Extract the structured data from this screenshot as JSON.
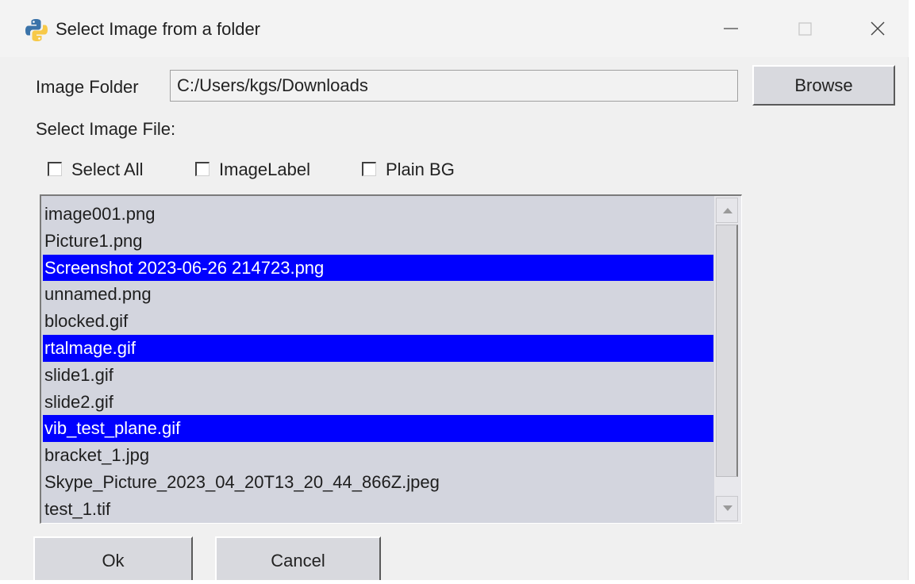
{
  "window": {
    "title": "Select Image from a folder",
    "app_icon": "python-icon",
    "controls": {
      "minimize_icon": "minimize-icon",
      "maximize_icon": "maximize-icon",
      "close_icon": "close-icon"
    }
  },
  "folder": {
    "label": "Image Folder",
    "value": "C:/Users/kgs/Downloads",
    "browse_label": "Browse"
  },
  "select_label": "Select Image File:",
  "checkboxes": [
    {
      "label": "Select All",
      "checked": false
    },
    {
      "label": "ImageLabel",
      "checked": false
    },
    {
      "label": "Plain BG",
      "checked": false
    }
  ],
  "files": [
    {
      "name": "image001.png",
      "selected": false
    },
    {
      "name": "Picture1.png",
      "selected": false
    },
    {
      "name": "Screenshot 2023-06-26 214723.png",
      "selected": true
    },
    {
      "name": "unnamed.png",
      "selected": false
    },
    {
      "name": "blocked.gif",
      "selected": false
    },
    {
      "name": "rtalmage.gif",
      "selected": true
    },
    {
      "name": "slide1.gif",
      "selected": false
    },
    {
      "name": "slide2.gif",
      "selected": false
    },
    {
      "name": "vib_test_plane.gif",
      "selected": true
    },
    {
      "name": "bracket_1.jpg",
      "selected": false
    },
    {
      "name": "Skype_Picture_2023_04_20T13_20_44_866Z.jpeg",
      "selected": false
    },
    {
      "name": "test_1.tif",
      "selected": false
    }
  ],
  "buttons": {
    "ok_label": "Ok",
    "cancel_label": "Cancel"
  },
  "colors": {
    "selection": "#0000ff",
    "list_background": "#d3d5de",
    "window_background": "#f0f0f0"
  }
}
